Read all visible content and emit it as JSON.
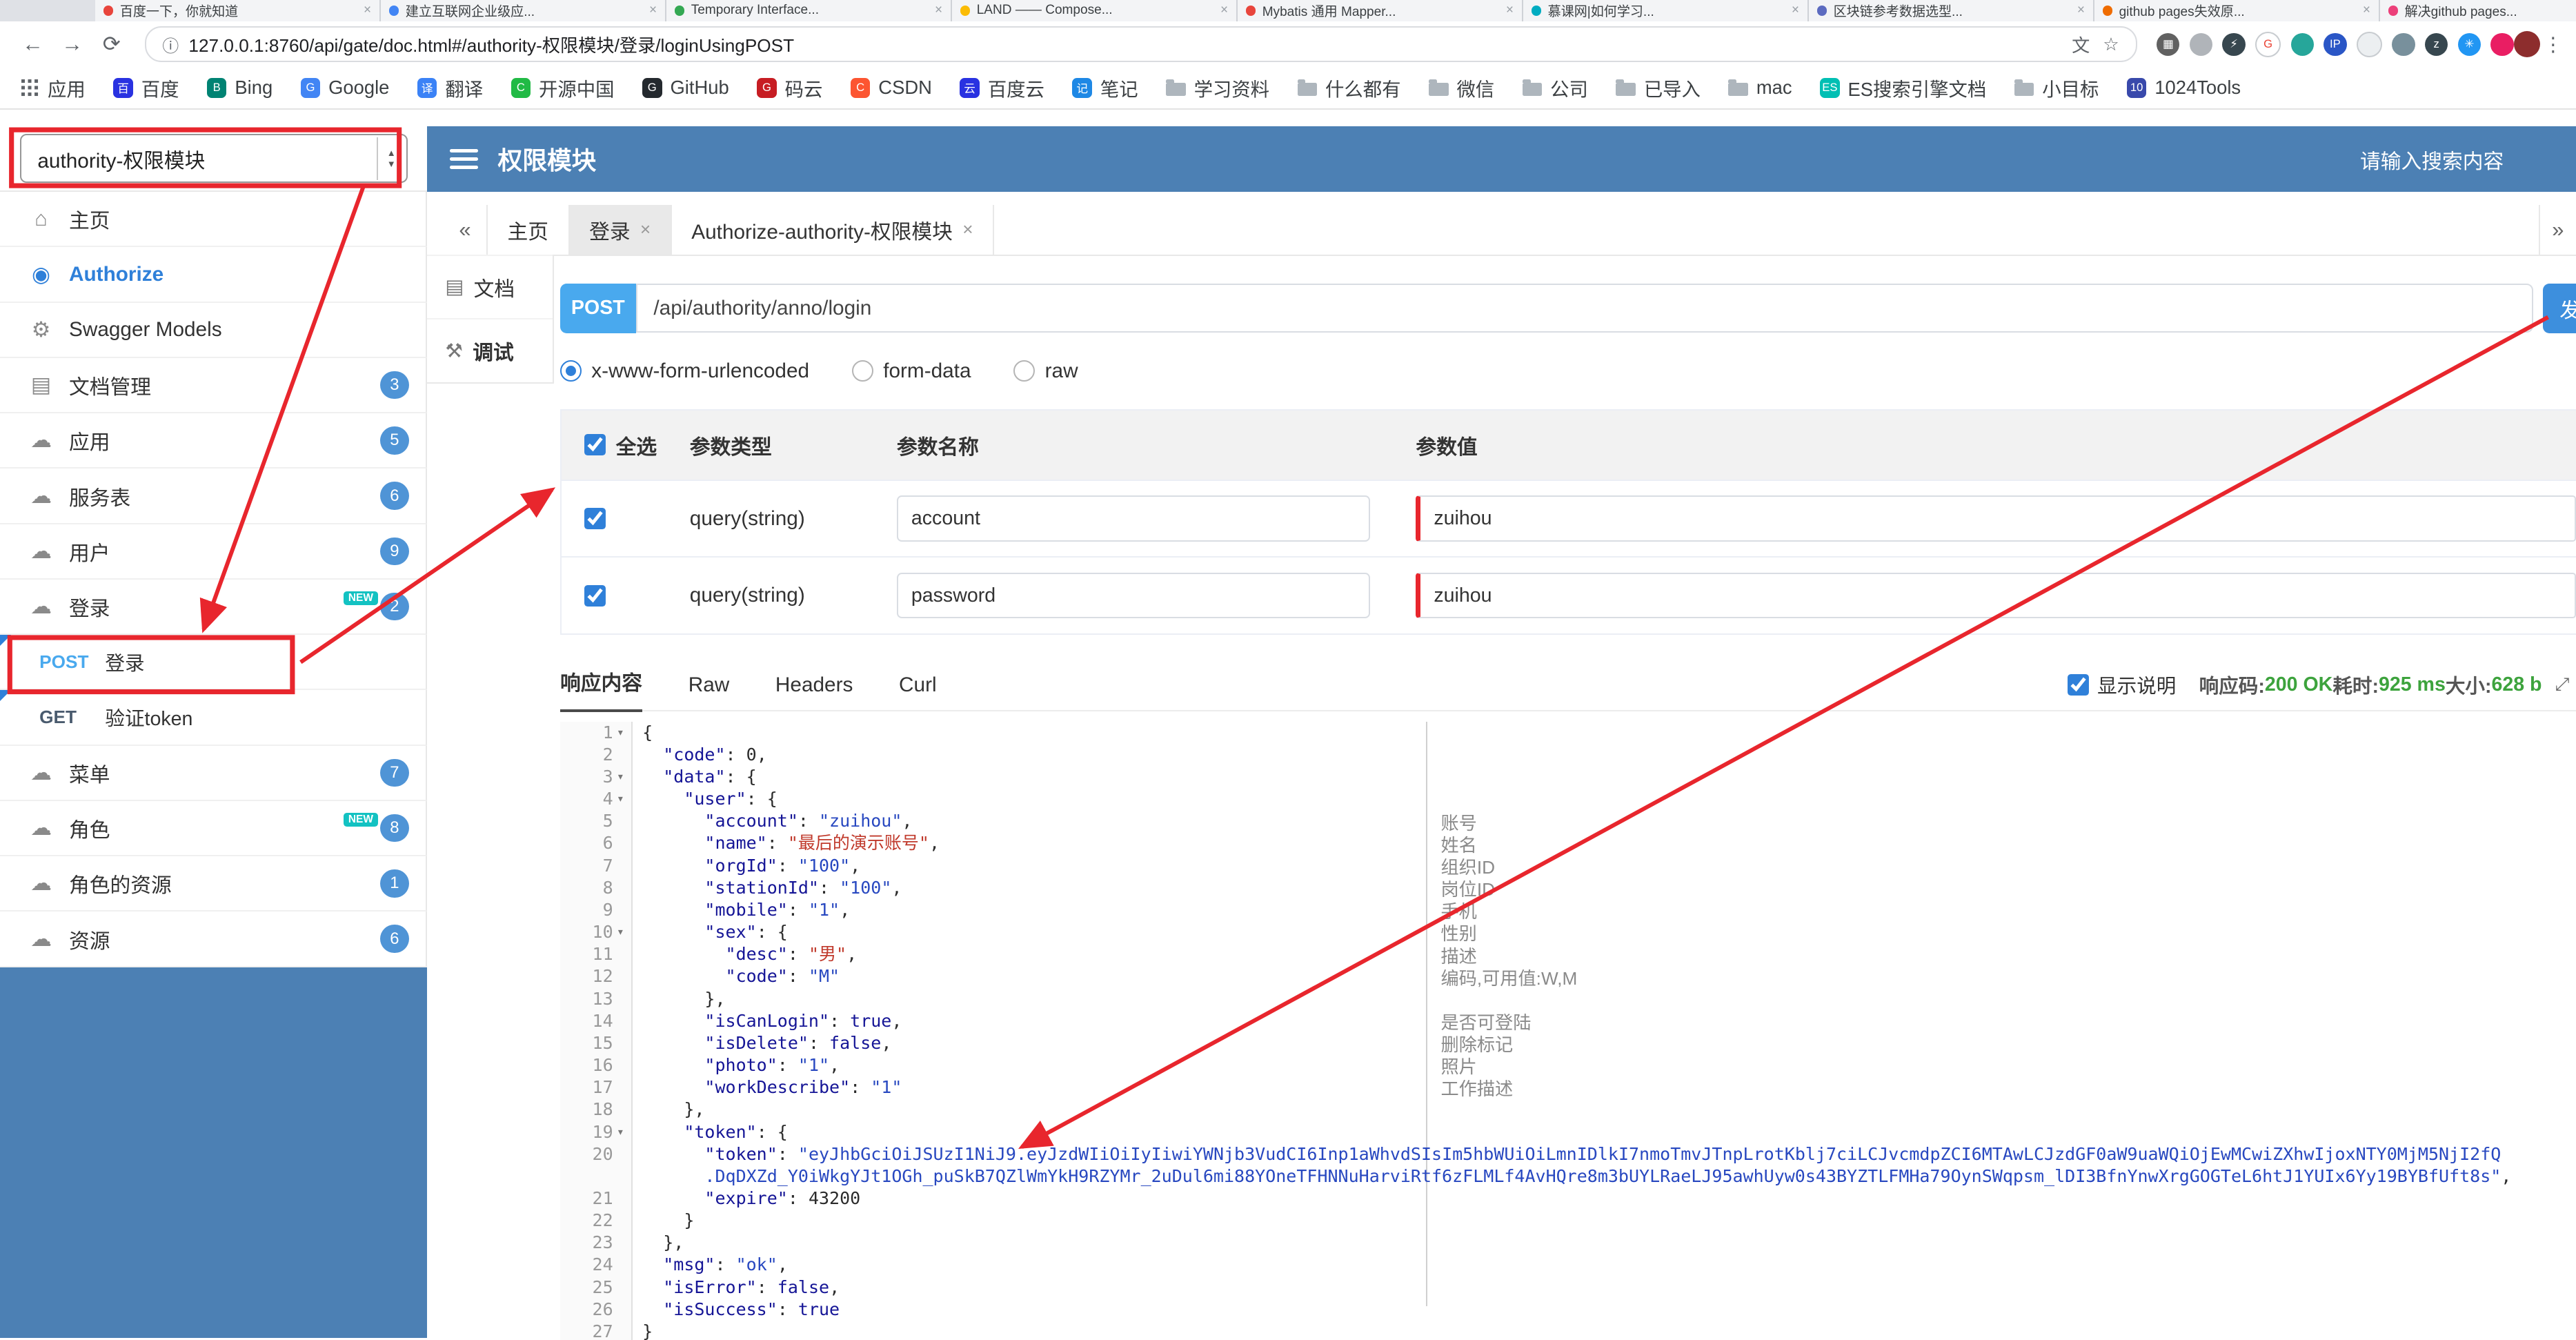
{
  "colors": {
    "blue_header": "#4c80b4",
    "badge": "#4f94d6",
    "accent": "#2f80d9",
    "post": "#49a9ee",
    "send": "#3d8fdd",
    "red": "#e8262d",
    "green": "#3da33d",
    "new": "#13c2c2"
  },
  "icons": {
    "back": "←",
    "forward": "→",
    "reload": "⟳",
    "info": "ⓘ",
    "star": "☆",
    "menu": "⋮",
    "close": "×",
    "collapse": "«",
    "expand": "»",
    "fold": "▾",
    "up": "▲",
    "down": "▼",
    "corner_expand": "⤢",
    "home": "⌂",
    "authorize": "◉",
    "models": "⚙",
    "docfile": "▤",
    "cloud": "☁",
    "debug": "⚒",
    "translate": "文"
  },
  "browser": {
    "url": "127.0.0.1:8760/api/gate/doc.html#/authority-权限模块/登录/loginUsingPOST",
    "tabs": [
      {
        "title": "百度一下，你就知道",
        "color": "#e8453c"
      },
      {
        "title": "建立互联网企业级应...",
        "color": "#4285f4"
      },
      {
        "title": "Temporary Interface...",
        "color": "#34a853"
      },
      {
        "title": "LAND —— Compose...",
        "color": "#fbbc05"
      },
      {
        "title": "Mybatis 通用 Mapper...",
        "color": "#e8453c"
      },
      {
        "title": "慕课网|如何学习...",
        "color": "#00acc1"
      },
      {
        "title": "区块链参考数据选型...",
        "color": "#5c6bc0"
      },
      {
        "title": "github pages失效原...",
        "color": "#ef6c00"
      },
      {
        "title": "解决github pages...",
        "color": "#ec407a"
      }
    ],
    "extensions": [
      {
        "color": "#616161",
        "glyph": "▦"
      },
      {
        "color": "#b0b4b9",
        "glyph": ""
      },
      {
        "color": "#37474f",
        "glyph": "⚡"
      },
      {
        "color": "#ffffff",
        "glyph": "G",
        "fg": "#ea4335",
        "border": true
      },
      {
        "color": "#26a69a",
        "glyph": ""
      },
      {
        "color": "#2a56c6",
        "glyph": "IP"
      },
      {
        "color": "#eceff1",
        "glyph": "",
        "border": true
      },
      {
        "color": "#78909c",
        "glyph": ""
      },
      {
        "color": "#37474f",
        "glyph": "z"
      },
      {
        "color": "#2196f3",
        "glyph": "✳"
      },
      {
        "color": "#e91e63",
        "glyph": ""
      }
    ],
    "bookmarks": [
      {
        "label": "应用",
        "kind": "apps"
      },
      {
        "label": "百度",
        "kind": "site",
        "color": "#2932e1",
        "letter": "百"
      },
      {
        "label": "Bing",
        "kind": "site",
        "color": "#008373",
        "letter": "B"
      },
      {
        "label": "Google",
        "kind": "site",
        "color": "#4285f4",
        "letter": "G"
      },
      {
        "label": "翻译",
        "kind": "site",
        "color": "#3b82f6",
        "letter": "译"
      },
      {
        "label": "开源中国",
        "kind": "site",
        "color": "#21ba45",
        "letter": "C"
      },
      {
        "label": "GitHub",
        "kind": "site",
        "color": "#24292e",
        "letter": "G"
      },
      {
        "label": "码云",
        "kind": "site",
        "color": "#c71d23",
        "letter": "G"
      },
      {
        "label": "CSDN",
        "kind": "site",
        "color": "#fc5531",
        "letter": "C"
      },
      {
        "label": "百度云",
        "kind": "site",
        "color": "#2932e1",
        "letter": "云"
      },
      {
        "label": "笔记",
        "kind": "site",
        "color": "#1e88e5",
        "letter": "记"
      },
      {
        "label": "学习资料",
        "kind": "folder"
      },
      {
        "label": "什么都有",
        "kind": "folder"
      },
      {
        "label": "微信",
        "kind": "folder"
      },
      {
        "label": "公司",
        "kind": "folder"
      },
      {
        "label": "已导入",
        "kind": "folder"
      },
      {
        "label": "mac",
        "kind": "folder"
      },
      {
        "label": "ES搜索引擎文档",
        "kind": "site",
        "color": "#00bfb3",
        "letter": "ES"
      },
      {
        "label": "小目标",
        "kind": "folder"
      },
      {
        "label": "1024Tools",
        "kind": "site",
        "color": "#3949ab",
        "letter": "10"
      }
    ]
  },
  "header": {
    "group_select": "authority-权限模块",
    "title": "权限模块",
    "search_placeholder": "请输入搜索内容"
  },
  "sidebar": {
    "items": [
      {
        "key": "home",
        "icon": "home",
        "label": "主页"
      },
      {
        "key": "authorize",
        "icon": "authorize",
        "label": "Authorize",
        "accent": true
      },
      {
        "key": "swagger-models",
        "icon": "models",
        "label": "Swagger Models"
      },
      {
        "key": "doc-manage",
        "icon": "docfile",
        "label": "文档管理",
        "badge": "3"
      },
      {
        "key": "app",
        "icon": "cloud",
        "label": "应用",
        "badge": "5"
      },
      {
        "key": "service",
        "icon": "cloud",
        "label": "服务表",
        "badge": "6"
      },
      {
        "key": "user",
        "icon": "cloud",
        "label": "用户",
        "badge": "9"
      },
      {
        "key": "login",
        "icon": "cloud",
        "label": "登录",
        "badge": "2",
        "new": true
      },
      {
        "key": "api-post-login",
        "method": "POST",
        "label": "登录"
      },
      {
        "key": "api-get-verify-token",
        "method": "GET",
        "label": "验证token"
      },
      {
        "key": "menu",
        "icon": "cloud",
        "label": "菜单",
        "badge": "7"
      },
      {
        "key": "role",
        "icon": "cloud",
        "label": "角色",
        "badge": "8",
        "new": true
      },
      {
        "key": "role-resource",
        "icon": "cloud",
        "label": "角色的资源",
        "badge": "1"
      },
      {
        "key": "resource",
        "icon": "cloud",
        "label": "资源",
        "badge": "6"
      }
    ]
  },
  "doc_tabs": [
    {
      "label": "主页",
      "closable": false
    },
    {
      "label": "登录",
      "closable": true,
      "active": true
    },
    {
      "label": "Authorize-authority-权限模块",
      "closable": true
    }
  ],
  "subnav": [
    {
      "key": "doc",
      "icon": "docfile",
      "label": "文档"
    },
    {
      "key": "debug",
      "icon": "debug",
      "label": "调试",
      "active": true
    }
  ],
  "request": {
    "method": "POST",
    "url": "/api/authority/anno/login",
    "send_label": "发送",
    "content_types": [
      {
        "label": "x-www-form-urlencoded",
        "checked": true
      },
      {
        "label": "form-data",
        "checked": false
      },
      {
        "label": "raw",
        "checked": false
      }
    ]
  },
  "params_table": {
    "select_all": "全选",
    "headers": [
      "参数类型",
      "参数名称",
      "参数值"
    ],
    "rows": [
      {
        "checked": true,
        "type": "query(string)",
        "name": "account",
        "value": "zuihou"
      },
      {
        "checked": true,
        "type": "query(string)",
        "name": "password",
        "value": "zuihou"
      }
    ]
  },
  "response": {
    "tabs": [
      "响应内容",
      "Raw",
      "Headers",
      "Curl"
    ],
    "active_tab": "响应内容",
    "show_desc_label": "显示说明",
    "code_label": "响应码:",
    "code_value": "200 OK",
    "time_label": "耗时:",
    "time_value": "925 ms",
    "size_label": "大小:",
    "size_value": "628 b"
  },
  "code": {
    "lines": [
      {
        "n": "1",
        "fold": true,
        "t": [
          [
            "p",
            "{"
          ]
        ]
      },
      {
        "n": "2",
        "t": [
          [
            "p",
            "  "
          ],
          [
            "k",
            "\"code\""
          ],
          [
            "p",
            ": "
          ],
          [
            "n",
            "0"
          ],
          [
            "p",
            ","
          ]
        ]
      },
      {
        "n": "3",
        "fold": true,
        "t": [
          [
            "p",
            "  "
          ],
          [
            "k",
            "\"data\""
          ],
          [
            "p",
            ": {"
          ]
        ]
      },
      {
        "n": "4",
        "fold": true,
        "t": [
          [
            "p",
            "    "
          ],
          [
            "k",
            "\"user\""
          ],
          [
            "p",
            ": {"
          ]
        ]
      },
      {
        "n": "5",
        "t": [
          [
            "p",
            "      "
          ],
          [
            "k",
            "\"account\""
          ],
          [
            "p",
            ": "
          ],
          [
            "s",
            "\"zuihou\""
          ],
          [
            "p",
            ","
          ]
        ]
      },
      {
        "n": "6",
        "t": [
          [
            "p",
            "      "
          ],
          [
            "k",
            "\"name\""
          ],
          [
            "p",
            ": "
          ],
          [
            "c",
            "\"最后的演示账号\""
          ],
          [
            "p",
            ","
          ]
        ]
      },
      {
        "n": "7",
        "t": [
          [
            "p",
            "      "
          ],
          [
            "k",
            "\"orgId\""
          ],
          [
            "p",
            ": "
          ],
          [
            "s",
            "\"100\""
          ],
          [
            "p",
            ","
          ]
        ]
      },
      {
        "n": "8",
        "t": [
          [
            "p",
            "      "
          ],
          [
            "k",
            "\"stationId\""
          ],
          [
            "p",
            ": "
          ],
          [
            "s",
            "\"100\""
          ],
          [
            "p",
            ","
          ]
        ]
      },
      {
        "n": "9",
        "t": [
          [
            "p",
            "      "
          ],
          [
            "k",
            "\"mobile\""
          ],
          [
            "p",
            ": "
          ],
          [
            "s",
            "\"1\""
          ],
          [
            "p",
            ","
          ]
        ]
      },
      {
        "n": "10",
        "fold": true,
        "t": [
          [
            "p",
            "      "
          ],
          [
            "k",
            "\"sex\""
          ],
          [
            "p",
            ": {"
          ]
        ]
      },
      {
        "n": "11",
        "t": [
          [
            "p",
            "        "
          ],
          [
            "k",
            "\"desc\""
          ],
          [
            "p",
            ": "
          ],
          [
            "c",
            "\"男\""
          ],
          [
            "p",
            ","
          ]
        ]
      },
      {
        "n": "12",
        "t": [
          [
            "p",
            "        "
          ],
          [
            "k",
            "\"code\""
          ],
          [
            "p",
            ": "
          ],
          [
            "s",
            "\"M\""
          ]
        ]
      },
      {
        "n": "13",
        "t": [
          [
            "p",
            "      },"
          ]
        ]
      },
      {
        "n": "14",
        "t": [
          [
            "p",
            "      "
          ],
          [
            "k",
            "\"isCanLogin\""
          ],
          [
            "p",
            ": "
          ],
          [
            "b",
            "true"
          ],
          [
            "p",
            ","
          ]
        ]
      },
      {
        "n": "15",
        "t": [
          [
            "p",
            "      "
          ],
          [
            "k",
            "\"isDelete\""
          ],
          [
            "p",
            ": "
          ],
          [
            "b",
            "false"
          ],
          [
            "p",
            ","
          ]
        ]
      },
      {
        "n": "16",
        "t": [
          [
            "p",
            "      "
          ],
          [
            "k",
            "\"photo\""
          ],
          [
            "p",
            ": "
          ],
          [
            "s",
            "\"1\""
          ],
          [
            "p",
            ","
          ]
        ]
      },
      {
        "n": "17",
        "t": [
          [
            "p",
            "      "
          ],
          [
            "k",
            "\"workDescribe\""
          ],
          [
            "p",
            ": "
          ],
          [
            "s",
            "\"1\""
          ]
        ]
      },
      {
        "n": "18",
        "t": [
          [
            "p",
            "    },"
          ]
        ]
      },
      {
        "n": "19",
        "fold": true,
        "t": [
          [
            "p",
            "    "
          ],
          [
            "k",
            "\"token\""
          ],
          [
            "p",
            ": {"
          ]
        ]
      },
      {
        "n": "20",
        "t": [
          [
            "p",
            "      "
          ],
          [
            "k",
            "\"token\""
          ],
          [
            "p",
            ": "
          ],
          [
            "s",
            "\"eyJhbGciOiJSUzI1NiJ9.eyJzdWIiOiIyIiwiYWNjb3VudCI6Inp1aWhvdSIsIm5hbWUiOiLmnIDlkI7nmoTmvJTnpLrotKblj7ciLCJvcmdpZCI6MTAwLCJzdGF0aW9uaWQiOjEwMCwiZXhwIjoxNTY0MjM5NjI2fQ"
          ]
        ]
      },
      {
        "n": "",
        "t": [
          [
            "p",
            "      "
          ],
          [
            "s",
            ".DqDXZd_Y0iWkgYJt1OGh_puSkB7QZlWmYkH9RZYMr_2uDul6mi88YOneTFHNNuHarviRtf6zFLMLf4AvHQre8m3bUYLRaeLJ95awhUyw0s43BYZTLFMHa79OynSWqpsm_lDI3BfnYnwXrgGOGTeL6htJ1YUIx6Yy19BYBfUft8s\""
          ],
          [
            "p",
            ","
          ]
        ]
      },
      {
        "n": "21",
        "t": [
          [
            "p",
            "      "
          ],
          [
            "k",
            "\"expire\""
          ],
          [
            "p",
            ": "
          ],
          [
            "n",
            "43200"
          ]
        ]
      },
      {
        "n": "22",
        "t": [
          [
            "p",
            "    }"
          ]
        ]
      },
      {
        "n": "23",
        "t": [
          [
            "p",
            "  },"
          ]
        ]
      },
      {
        "n": "24",
        "t": [
          [
            "p",
            "  "
          ],
          [
            "k",
            "\"msg\""
          ],
          [
            "p",
            ": "
          ],
          [
            "s",
            "\"ok\""
          ],
          [
            "p",
            ","
          ]
        ]
      },
      {
        "n": "25",
        "t": [
          [
            "p",
            "  "
          ],
          [
            "k",
            "\"isError\""
          ],
          [
            "p",
            ": "
          ],
          [
            "b",
            "false"
          ],
          [
            "p",
            ","
          ]
        ]
      },
      {
        "n": "26",
        "t": [
          [
            "p",
            "  "
          ],
          [
            "k",
            "\"isSuccess\""
          ],
          [
            "p",
            ": "
          ],
          [
            "b",
            "true"
          ]
        ]
      },
      {
        "n": "27",
        "t": [
          [
            "p",
            "}"
          ]
        ]
      }
    ],
    "annotations": [
      {
        "line": 5,
        "text": "账号"
      },
      {
        "line": 6,
        "text": "姓名"
      },
      {
        "line": 7,
        "text": "组织ID"
      },
      {
        "line": 8,
        "text": "岗位ID"
      },
      {
        "line": 9,
        "text": "手机"
      },
      {
        "line": 10,
        "text": "性别"
      },
      {
        "line": 11,
        "text": "描述"
      },
      {
        "line": 12,
        "text": "编码,可用值:W,M"
      },
      {
        "line": 14,
        "text": "是否可登陆"
      },
      {
        "line": 15,
        "text": "删除标记"
      },
      {
        "line": 16,
        "text": "照片"
      },
      {
        "line": 17,
        "text": "工作描述"
      }
    ]
  }
}
